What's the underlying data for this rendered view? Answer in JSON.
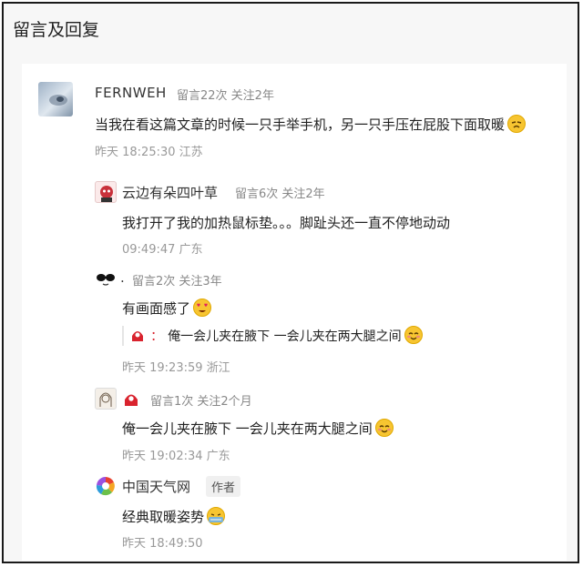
{
  "page": {
    "title": "留言及回复"
  },
  "comments": {
    "main": {
      "username": "FERNWEH",
      "stats": "留言22次 关注2年",
      "text": "当我在看这篇文章的时候一只手举手机，另一只手压在屁股下面取暖",
      "time": "昨天 18:25:30 江苏",
      "avatar_icon": "blurred-face-avatar-icon",
      "emoji_icon": "cold-face-emoji-icon"
    },
    "replies": [
      {
        "username": "云边有朵四叶草",
        "stats": "留言6次 关注2年",
        "text": "我打开了我的加热鼠标垫。。。脚趾头还一直不停地动动",
        "time": "09:49:47 广东",
        "avatar_icon": "cartoon-character-avatar-icon"
      },
      {
        "username": ".",
        "stats": "留言2次 关注3年",
        "text": "有画面感了",
        "quote_text": "俺一会儿夹在腋下 一会儿夹在两大腿之间",
        "time": "昨天 19:23:59 浙江",
        "avatar_icon": "sunglasses-cat-avatar-icon",
        "emoji_icon": "heart-eyes-emoji-icon",
        "quote_emoji_icon": "blush-smile-emoji-icon"
      },
      {
        "username": "",
        "stats": "留言1次 关注2个月",
        "text": "俺一会儿夹在腋下 一会儿夹在两大腿之间",
        "time": "昨天 19:02:34 广东",
        "avatar_icon": "sketch-portrait-avatar-icon",
        "emoji_icon": "blush-smile-emoji-icon"
      },
      {
        "username": "中国天气网",
        "author_tag": "作者",
        "text": "经典取暖姿势",
        "time": "昨天 18:49:50",
        "avatar_icon": "weather-network-logo-icon",
        "emoji_icon": "shivering-face-emoji-icon"
      }
    ]
  },
  "colors": {
    "accent_red": "#d9232e",
    "name_gray": "#333333",
    "meta_gray": "#888888"
  }
}
